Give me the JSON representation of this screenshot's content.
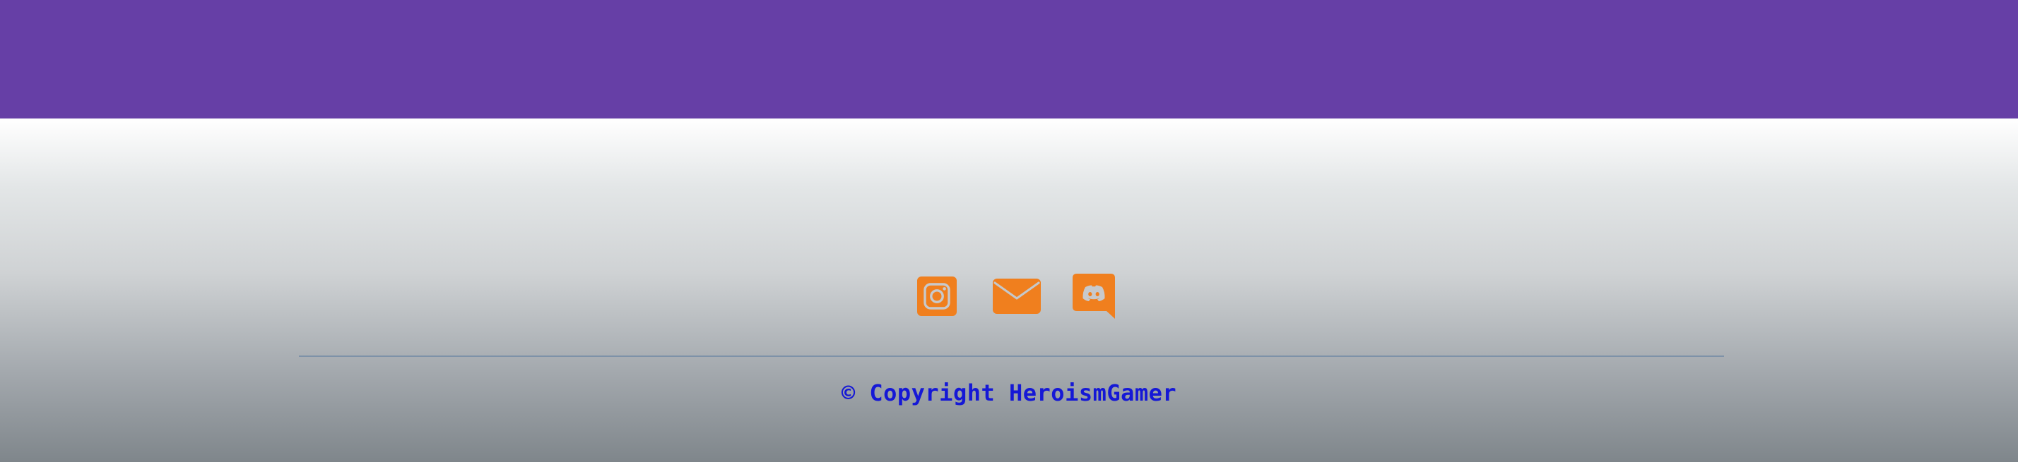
{
  "header": {
    "band_color": "#663fa6"
  },
  "footer": {
    "social": [
      {
        "name": "instagram-icon",
        "color": "#f07f1e"
      },
      {
        "name": "mail-icon",
        "color": "#f07f1e"
      },
      {
        "name": "discord-icon",
        "color": "#f07f1e"
      }
    ],
    "copyright_text": "© Copyright HeroismGamer",
    "copyright_color": "#1518d6",
    "divider_color": "#7e92a8"
  }
}
